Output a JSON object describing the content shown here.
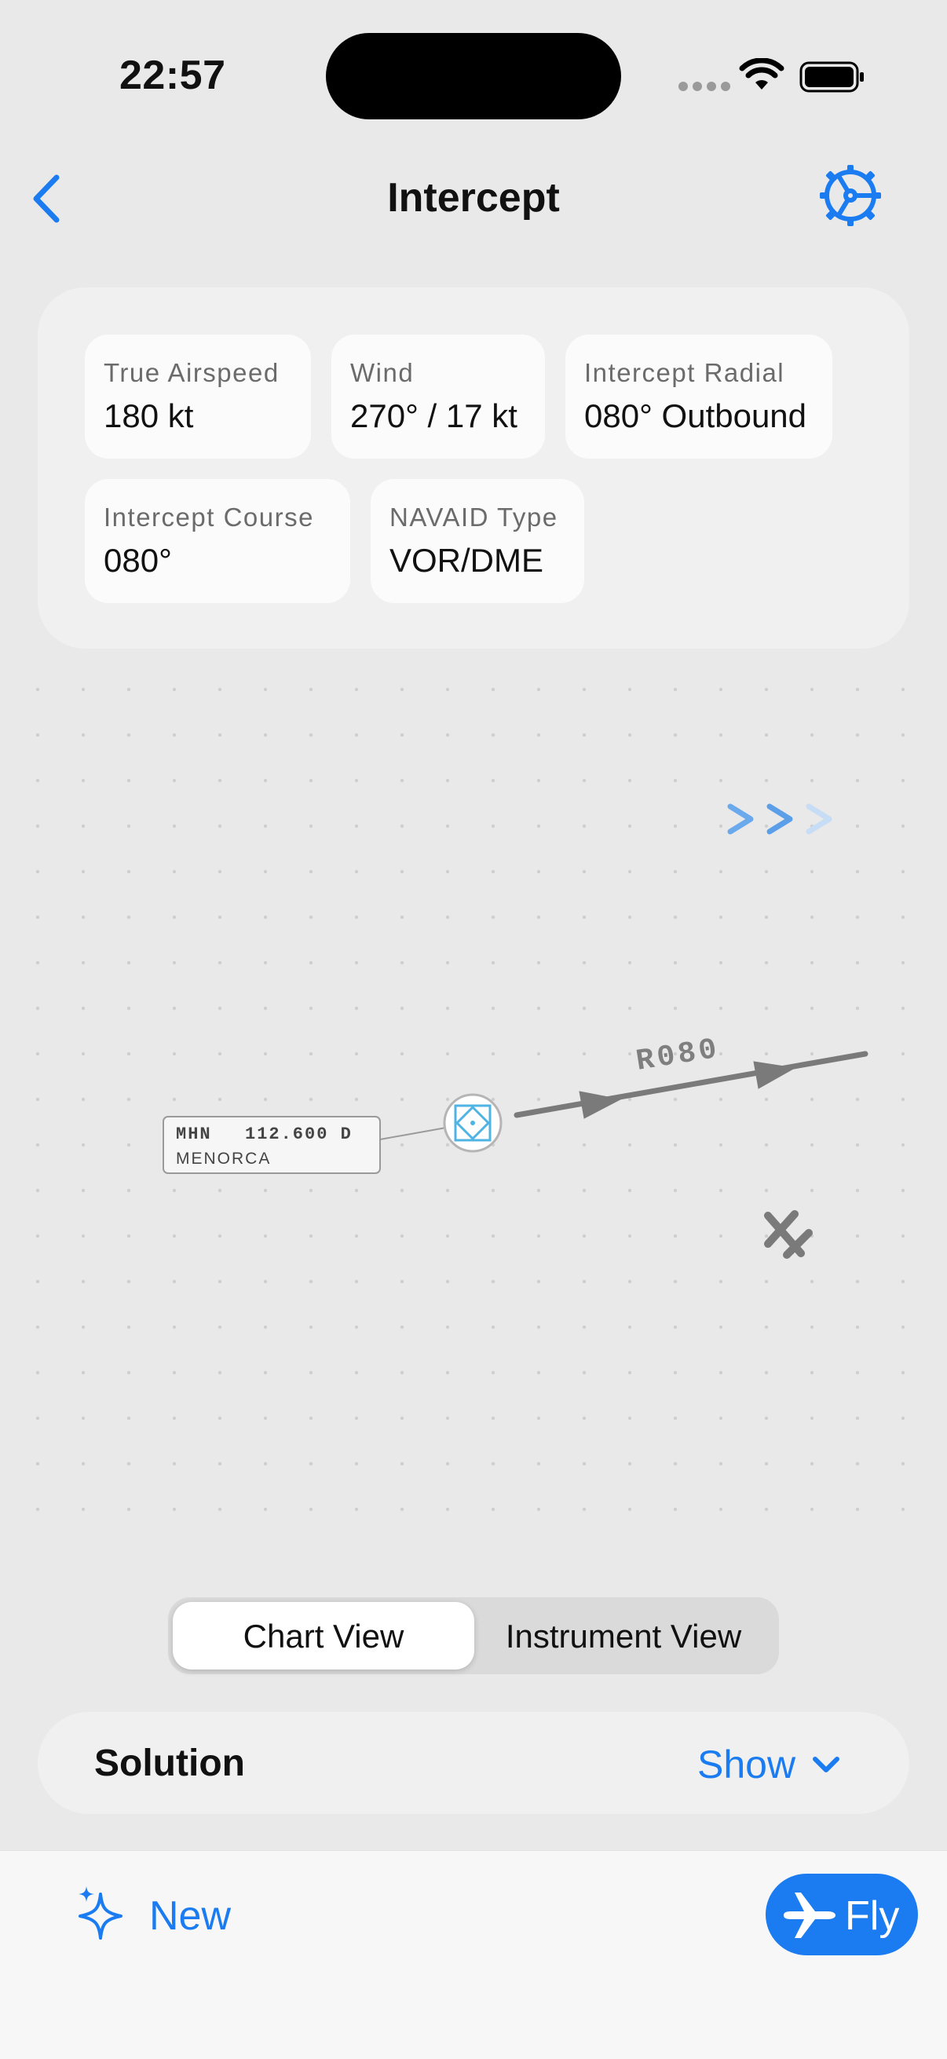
{
  "status": {
    "time": "22:57"
  },
  "nav": {
    "title": "Intercept"
  },
  "params": [
    {
      "label": "True Airspeed",
      "value": "180 kt"
    },
    {
      "label": "Wind",
      "value": "270° / 17 kt"
    },
    {
      "label": "Intercept Radial",
      "value": "080° Outbound"
    },
    {
      "label": "Intercept Course",
      "value": "080°"
    },
    {
      "label": "NAVAID Type",
      "value": "VOR/DME"
    }
  ],
  "chart": {
    "navaid_ident": "MHN",
    "navaid_freq": "112.600 D",
    "navaid_name": "MENORCA",
    "radial_label": "R080",
    "colors": {
      "navaid": "#4fb3e3",
      "radial": "#7a7a7a",
      "wind": "#1a7cf0"
    }
  },
  "view_toggle": {
    "chart": "Chart View",
    "instrument": "Instrument View",
    "selected": "Chart View"
  },
  "solution": {
    "label": "Solution",
    "action": "Show"
  },
  "bottom": {
    "new_label": "New",
    "fly_label": "Fly"
  },
  "icons": [
    "back-chevron-icon",
    "gear-icon",
    "vor-dme-icon",
    "aircraft-icon",
    "wind-chevrons-icon",
    "sparkles-icon",
    "airplane-icon",
    "chevron-down-icon"
  ]
}
